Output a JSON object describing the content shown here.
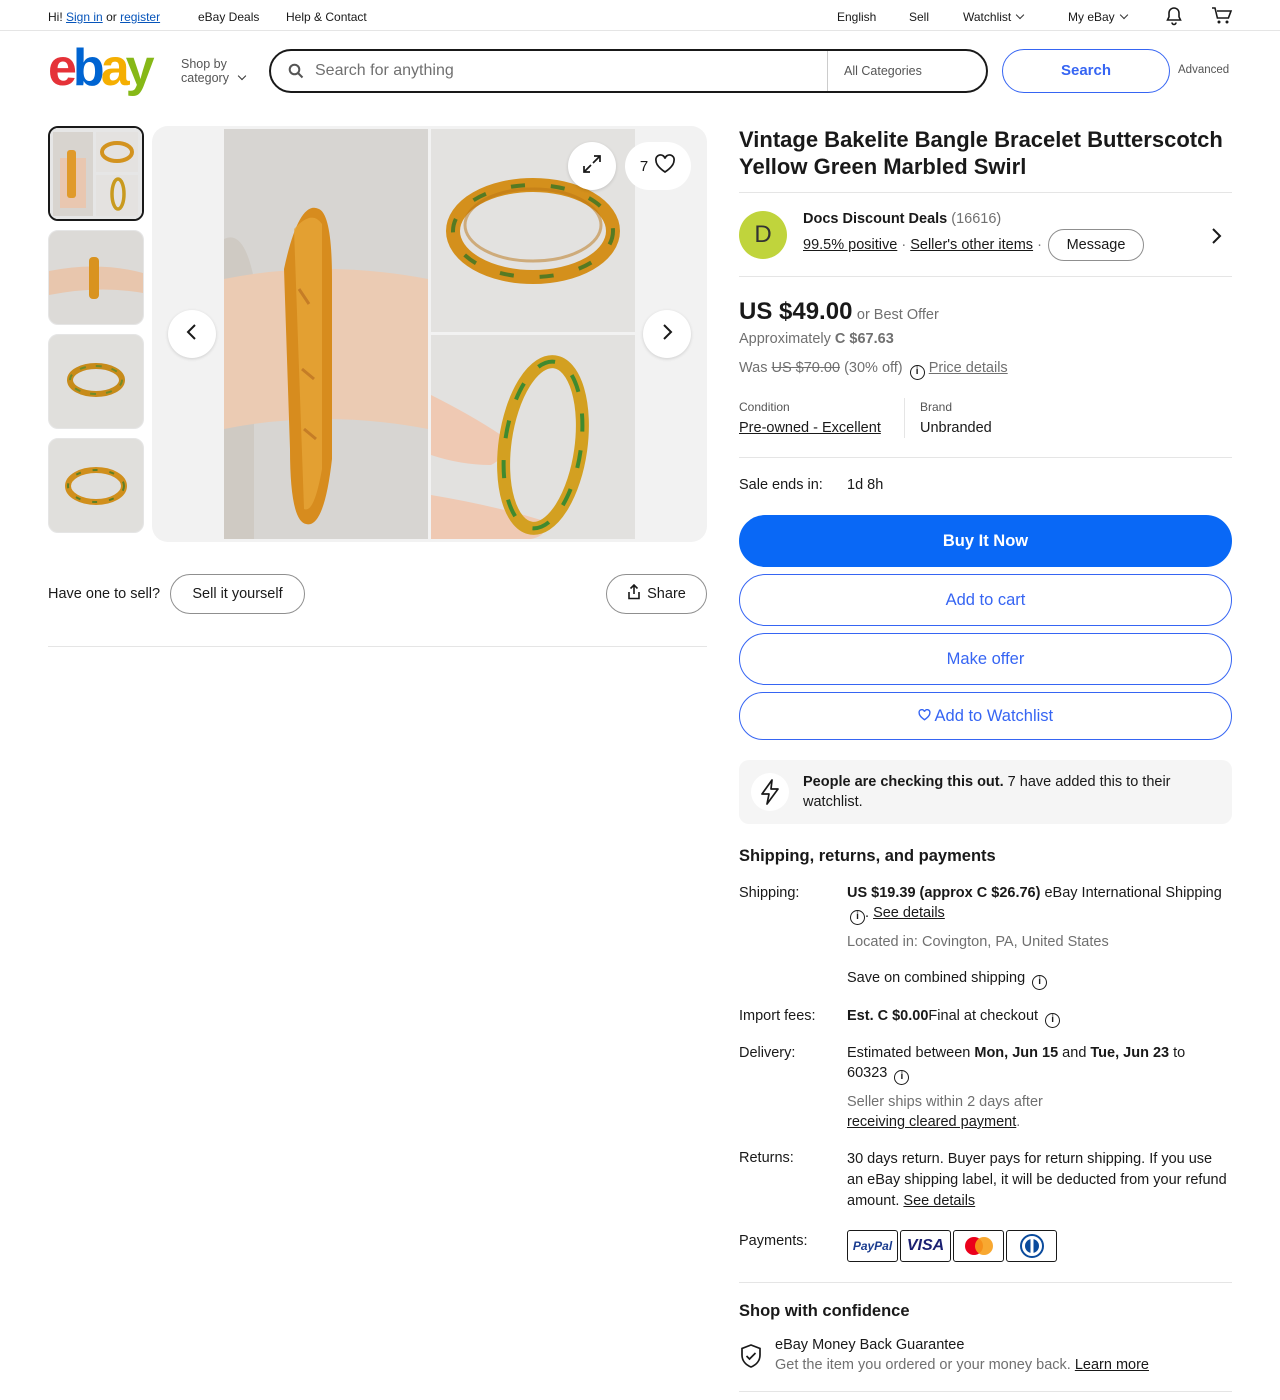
{
  "topbar": {
    "greeting": "Hi!",
    "sign_in": "Sign in",
    "or": "or",
    "register": "register",
    "deals": "eBay Deals",
    "help": "Help & Contact",
    "language": "English",
    "sell": "Sell",
    "watchlist": "Watchlist",
    "my_ebay": "My eBay"
  },
  "header": {
    "logo_letters": [
      "e",
      "b",
      "a",
      "y"
    ],
    "logo_colors": [
      "#e53238",
      "#0064d2",
      "#f5af02",
      "#86b817"
    ],
    "shop_by_1": "Shop by",
    "shop_by_2": "category",
    "search_placeholder": "Search for anything",
    "category": "All Categories",
    "search_button": "Search",
    "advanced": "Advanced"
  },
  "gallery": {
    "watch_count": "7",
    "thumbnail_count": 4
  },
  "below_gallery": {
    "have_one": "Have one to sell?",
    "sell_it": "Sell it yourself",
    "share": "Share"
  },
  "item": {
    "title": "Vintage Bakelite Bangle Bracelet Butterscotch Yellow Green Marbled Swirl"
  },
  "seller": {
    "initial": "D",
    "name": "Docs Discount Deals",
    "feedback": "(16616)",
    "positive": "99.5% positive",
    "other_items": "Seller's other items",
    "message": "Message"
  },
  "price": {
    "current": "US $49.00",
    "best_offer": "or Best Offer",
    "approx_label": "Approximately",
    "approx_value": "C $67.63",
    "was_label": "Was",
    "was_value": "US $70.00",
    "discount": "(30% off)",
    "price_details": "Price details"
  },
  "specs": {
    "condition_label": "Condition",
    "condition_value": "Pre-owned - Excellent",
    "brand_label": "Brand",
    "brand_value": "Unbranded"
  },
  "sale": {
    "label": "Sale ends in:",
    "value": "1d 8h"
  },
  "actions": {
    "buy_now": "Buy It Now",
    "add_cart": "Add to cart",
    "make_offer": "Make offer",
    "watchlist": "Add to Watchlist"
  },
  "checking": {
    "bold": "People are checking this out.",
    "rest": " 7 have added this to their watchlist."
  },
  "shipping": {
    "heading": "Shipping, returns, and payments",
    "shipping_label": "Shipping:",
    "shipping_price": "US $19.39 (approx C $26.76)",
    "shipping_service": " eBay International Shipping",
    "see_details": "See details",
    "located": "Located in: Covington, PA, United States",
    "combined": "Save on combined shipping",
    "import_label": "Import fees:",
    "import_value": "Est. C $0.00",
    "import_note": "Final at checkout",
    "delivery_label": "Delivery:",
    "delivery_pre": "Estimated between ",
    "delivery_start": "Mon, Jun 15",
    "delivery_and": " and ",
    "delivery_end": "Tue, Jun 23",
    "delivery_to": " to 60323",
    "ships_within": "Seller ships within 2 days after ",
    "cleared": "receiving cleared payment",
    "period": ".",
    "returns_label": "Returns:",
    "returns_text": "30 days return. Buyer pays for return shipping. If you use an eBay shipping label, it will be deducted from your refund amount. ",
    "returns_details": "See details",
    "payments_label": "Payments:",
    "paypal": "PayPal",
    "visa": "VISA"
  },
  "confidence": {
    "heading": "Shop with confidence",
    "guarantee": "eBay Money Back Guarantee",
    "desc": "Get the item you ordered or your money back. ",
    "learn": "Learn more"
  }
}
